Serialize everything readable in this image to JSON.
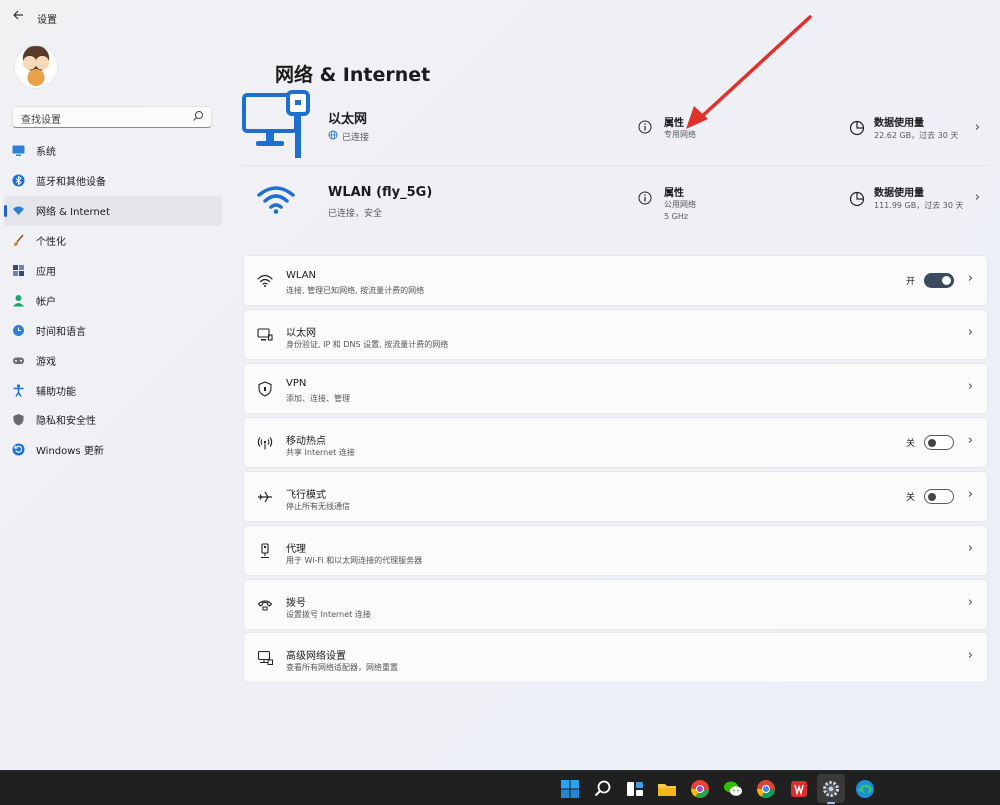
{
  "window": {
    "title": "设置",
    "back_icon": "back-arrow-icon"
  },
  "sidebar": {
    "search": {
      "placeholder": "查找设置"
    },
    "items": [
      {
        "label": "系统",
        "icon": "monitor-icon",
        "color": "#2f7fd6"
      },
      {
        "label": "蓝牙和其他设备",
        "icon": "bluetooth-icon",
        "color": "#1a73d9"
      },
      {
        "label": "网络 & Internet",
        "icon": "wifi-icon",
        "color": "#2f7fd6",
        "selected": true
      },
      {
        "label": "个性化",
        "icon": "brush-icon",
        "color": "#d9822b"
      },
      {
        "label": "应用",
        "icon": "apps-icon",
        "color": "#3a4a6a"
      },
      {
        "label": "帐户",
        "icon": "person-icon",
        "color": "#1fa46b"
      },
      {
        "label": "时间和语言",
        "icon": "globe-clock-icon",
        "color": "#2f7fd6"
      },
      {
        "label": "游戏",
        "icon": "gamepad-icon",
        "color": "#6a6a6a"
      },
      {
        "label": "辅助功能",
        "icon": "accessibility-icon",
        "color": "#1a73d9"
      },
      {
        "label": "隐私和安全性",
        "icon": "shield-icon",
        "color": "#6a6a6a"
      },
      {
        "label": "Windows 更新",
        "icon": "update-icon",
        "color": "#1a73d9"
      }
    ]
  },
  "main": {
    "title": "网络 & Internet",
    "connections": [
      {
        "name": "以太网",
        "status": "已连接",
        "properties_label": "属性",
        "properties_sub": [
          "专用网络"
        ],
        "data_label": "数据使用量",
        "data_sub": "22.62 GB，过去 30 天"
      },
      {
        "name": "WLAN (fly_5G)",
        "status": "已连接，安全",
        "properties_label": "属性",
        "properties_sub": [
          "公用网络",
          "5 GHz"
        ],
        "data_label": "数据使用量",
        "data_sub": "111.99 GB，过去 30 天"
      }
    ],
    "cards": [
      {
        "title": "WLAN",
        "subtitle": "连接, 管理已知网络, 按流量计费的网络",
        "icon": "wifi-icon",
        "toggle": "开",
        "toggle_on": true
      },
      {
        "title": "以太网",
        "subtitle": "身份验证, IP 和 DNS 设置, 按流量计费的网络",
        "icon": "ethernet-icon"
      },
      {
        "title": "VPN",
        "subtitle": "添加、连接、管理",
        "icon": "vpn-shield-icon"
      },
      {
        "title": "移动热点",
        "subtitle": "共享 Internet 连接",
        "icon": "hotspot-icon",
        "toggle": "关",
        "toggle_on": false
      },
      {
        "title": "飞行模式",
        "subtitle": "停止所有无线通信",
        "icon": "airplane-icon",
        "toggle": "关",
        "toggle_on": false
      },
      {
        "title": "代理",
        "subtitle": "用于 Wi-Fi 和以太网连接的代理服务器",
        "icon": "proxy-icon"
      },
      {
        "title": "拨号",
        "subtitle": "设置拨号 Internet 连接",
        "icon": "dialup-icon"
      },
      {
        "title": "高级网络设置",
        "subtitle": "查看所有网络适配器，网络重置",
        "icon": "network-adapter-icon"
      }
    ]
  },
  "annotation": {
    "color": "#e0312b"
  },
  "taskbar": {
    "icons": [
      "windows-start-icon",
      "search-icon",
      "task-view-icon",
      "file-explorer-icon",
      "chrome-like-icon",
      "wechat-icon",
      "chrome-icon",
      "wps-icon",
      "settings-gear-icon",
      "edge-icon"
    ]
  },
  "colors": {
    "accent": "#2260d6",
    "toggle_on": "#3b4a5e"
  }
}
